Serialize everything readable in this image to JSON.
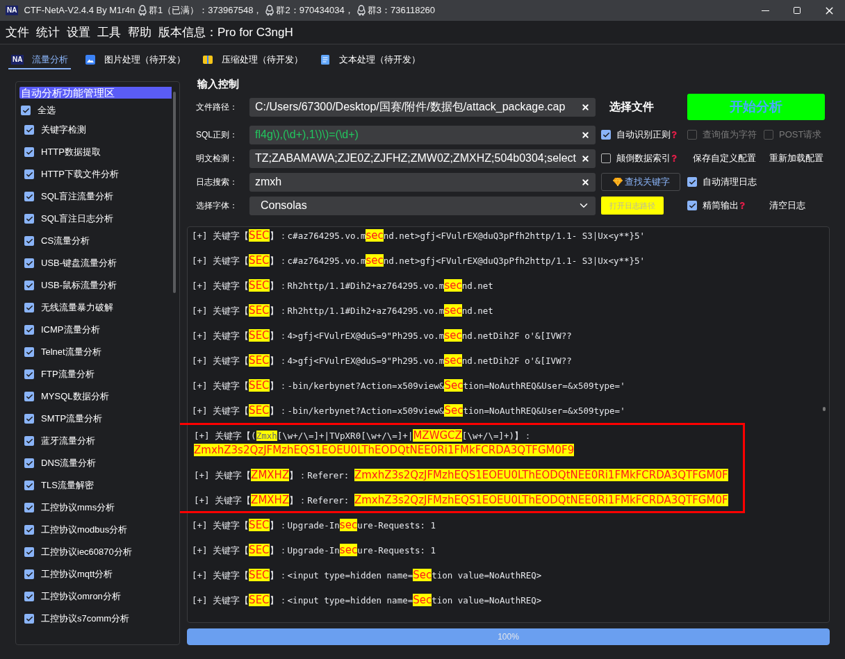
{
  "window": {
    "icon_text": "NA",
    "title": "CTF-NetA-V2.4.4 By M1r4n",
    "groups": [
      "群1（已满）：373967548，",
      "群2：970434034，",
      "群3：736118260"
    ]
  },
  "menu": [
    "文件",
    "统计",
    "设置",
    "工具",
    "帮助",
    "版本信息：Pro for C3ngH"
  ],
  "tabs": [
    {
      "label": "流量分析",
      "selected": true,
      "kind": "badge",
      "icon_text": "NA"
    },
    {
      "label": "图片处理（待开发）",
      "selected": false,
      "kind": "image"
    },
    {
      "label": "压缩处理（待开发）",
      "selected": false,
      "kind": "archive"
    },
    {
      "label": "文本处理（待开发）",
      "selected": false,
      "kind": "document"
    }
  ],
  "sidebar": {
    "title": "自动分析功能管理区",
    "select_all": {
      "label": "全选",
      "checked": true
    },
    "items": [
      {
        "label": "关键字检测",
        "checked": true
      },
      {
        "label": "HTTP数据提取",
        "checked": true
      },
      {
        "label": "HTTP下载文件分析",
        "checked": true
      },
      {
        "label": "SQL盲注流量分析",
        "checked": true
      },
      {
        "label": "SQL盲注日志分析",
        "checked": true
      },
      {
        "label": "CS流量分析",
        "checked": true
      },
      {
        "label": "USB-键盘流量分析",
        "checked": true
      },
      {
        "label": "USB-鼠标流量分析",
        "checked": true
      },
      {
        "label": "无线流量暴力破解",
        "checked": true
      },
      {
        "label": "ICMP流量分析",
        "checked": true
      },
      {
        "label": "Telnet流量分析",
        "checked": true
      },
      {
        "label": "FTP流量分析",
        "checked": true
      },
      {
        "label": "MYSQL数据分析",
        "checked": true
      },
      {
        "label": "SMTP流量分析",
        "checked": true
      },
      {
        "label": "蓝牙流量分析",
        "checked": true
      },
      {
        "label": "DNS流量分析",
        "checked": true
      },
      {
        "label": "TLS流量解密",
        "checked": true
      },
      {
        "label": "工控协议mms分析",
        "checked": true
      },
      {
        "label": "工控协议modbus分析",
        "checked": true
      },
      {
        "label": "工控协议iec60870分析",
        "checked": true
      },
      {
        "label": "工控协议mqtt分析",
        "checked": true
      },
      {
        "label": "工控协议omron分析",
        "checked": true
      },
      {
        "label": "工控协议s7comm分析",
        "checked": true
      }
    ]
  },
  "input_control": {
    "title": "输入控制",
    "rows": [
      {
        "label": "文件路径：",
        "field": {
          "kind": "text",
          "value": "C:/Users/67300/Desktop/国赛/附件/数据包/attack_package.cap"
        },
        "controls": [
          {
            "kind": "text-button",
            "label": "选择文件"
          },
          {
            "kind": "primary-button",
            "label": "开始分析"
          }
        ]
      },
      {
        "label": "SQL正则：",
        "field": {
          "kind": "regex",
          "value": "fl4g\\),(\\d+),1\\)\\)=(\\d+)"
        },
        "controls": [
          {
            "kind": "checkbox",
            "label": "自动识别正则",
            "checked": true,
            "disabled": false,
            "help": true
          },
          {
            "kind": "checkbox",
            "label": "查询值为字符",
            "checked": false,
            "disabled": true,
            "help": false
          },
          {
            "kind": "checkbox",
            "label": "POST请求",
            "checked": false,
            "disabled": true,
            "help": false
          }
        ]
      },
      {
        "label": "明文检测：",
        "field": {
          "kind": "text",
          "value": "TZ;ZABAMAWA;ZJE0Z;ZJFHZ;ZMW0Z;ZMXHZ;504b0304;select"
        },
        "controls": [
          {
            "kind": "checkbox",
            "label": "颠倒数据索引",
            "checked": false,
            "disabled": false,
            "help": true
          },
          {
            "kind": "small-button",
            "label": "保存自定义配置"
          },
          {
            "kind": "small-button",
            "label": "重新加载配置"
          }
        ]
      },
      {
        "label": "日志搜索：",
        "field": {
          "kind": "text",
          "value": "zmxh"
        },
        "controls": [
          {
            "kind": "search-button",
            "label": "查找关键字"
          },
          {
            "kind": "checkbox",
            "label": "自动清理日志",
            "checked": true,
            "disabled": false,
            "help": false
          }
        ]
      },
      {
        "label": "选择字体：",
        "field": {
          "kind": "select",
          "value": "Consolas"
        },
        "controls": [
          {
            "kind": "yellow-button",
            "label": "打开日志路径"
          },
          {
            "kind": "checkbox",
            "label": "精简输出",
            "checked": true,
            "disabled": false,
            "help": true
          },
          {
            "kind": "small-button",
            "label": "清空日志"
          }
        ]
      }
    ]
  },
  "log": [
    {
      "boxed": false,
      "entries": [
        [
          [
            {
              "text": "[+] 关键字【",
              "kind": "plain"
            },
            {
              "text": "SEC",
              "kind": "keyword"
            },
            {
              "text": "】：c#az764295.vo.m",
              "kind": "plain"
            },
            {
              "text": "sec",
              "kind": "keyword"
            },
            {
              "text": "nd.net>gfj<FVulrEX@duQ3pPfh2http/1.1- S3|Ux<y**}5'",
              "kind": "plain"
            }
          ]
        ],
        [
          [
            {
              "text": "[+] 关键字【",
              "kind": "plain"
            },
            {
              "text": "SEC",
              "kind": "keyword"
            },
            {
              "text": "】：c#az764295.vo.m",
              "kind": "plain"
            },
            {
              "text": "sec",
              "kind": "keyword"
            },
            {
              "text": "nd.net>gfj<FVulrEX@duQ3pPfh2http/1.1- S3|Ux<y**}5'",
              "kind": "plain"
            }
          ]
        ],
        [
          [
            {
              "text": "[+] 关键字【",
              "kind": "plain"
            },
            {
              "text": "SEC",
              "kind": "keyword"
            },
            {
              "text": "】：Rh2http/1.1#Dih2+az764295.vo.m",
              "kind": "plain"
            },
            {
              "text": "sec",
              "kind": "keyword"
            },
            {
              "text": "nd.net",
              "kind": "plain"
            }
          ]
        ],
        [
          [
            {
              "text": "[+] 关键字【",
              "kind": "plain"
            },
            {
              "text": "SEC",
              "kind": "keyword"
            },
            {
              "text": "】：Rh2http/1.1#Dih2+az764295.vo.m",
              "kind": "plain"
            },
            {
              "text": "sec",
              "kind": "keyword"
            },
            {
              "text": "nd.net",
              "kind": "plain"
            }
          ]
        ],
        [
          [
            {
              "text": "[+] 关键字【",
              "kind": "plain"
            },
            {
              "text": "SEC",
              "kind": "keyword"
            },
            {
              "text": "】：4>gfj<FVulrEX@duS=9\"Ph295.vo.m",
              "kind": "plain"
            },
            {
              "text": "sec",
              "kind": "keyword"
            },
            {
              "text": "nd.netDih2F o'&[IVW??",
              "kind": "plain"
            }
          ]
        ],
        [
          [
            {
              "text": "[+] 关键字【",
              "kind": "plain"
            },
            {
              "text": "SEC",
              "kind": "keyword"
            },
            {
              "text": "】：4>gfj<FVulrEX@duS=9\"Ph295.vo.m",
              "kind": "plain"
            },
            {
              "text": "sec",
              "kind": "keyword"
            },
            {
              "text": "nd.netDih2F o'&[IVW??",
              "kind": "plain"
            }
          ]
        ],
        [
          [
            {
              "text": "[+] 关键字【",
              "kind": "plain"
            },
            {
              "text": "SEC",
              "kind": "keyword"
            },
            {
              "text": "】：-bin/kerbynet?Action=x509view&",
              "kind": "plain"
            },
            {
              "text": "Sec",
              "kind": "keyword"
            },
            {
              "text": "tion=NoAuthREQ&User=&x509type='",
              "kind": "plain"
            }
          ]
        ],
        [
          [
            {
              "text": "[+] 关键字【",
              "kind": "plain"
            },
            {
              "text": "SEC",
              "kind": "keyword"
            },
            {
              "text": "】：-bin/kerbynet?Action=x509view&",
              "kind": "plain"
            },
            {
              "text": "Sec",
              "kind": "keyword"
            },
            {
              "text": "tion=NoAuthREQ&User=&x509type='",
              "kind": "plain"
            }
          ]
        ]
      ]
    },
    {
      "boxed": true,
      "entries": [
        [
          [
            {
              "text": "[+] 关键字【(",
              "kind": "plain"
            },
            {
              "text": "Zmxh",
              "kind": "faint-keyword"
            },
            {
              "text": "[\\w+/\\=]+|TVpXR0[\\w+/\\=]+|",
              "kind": "plain"
            },
            {
              "text": "MZWGCZ",
              "kind": "keyword"
            },
            {
              "text": "[\\w+/\\=]+)】：",
              "kind": "plain"
            }
          ],
          [
            {
              "text": "ZmxhZ3s2QzJFMzhEQS1EOEU0LThEODQtNEE0Ri1FMkFCRDA3QTFGM0F9",
              "kind": "keyword"
            }
          ]
        ],
        [
          [
            {
              "text": "[+] 关键字【",
              "kind": "plain"
            },
            {
              "text": "ZMXHZ",
              "kind": "keyword"
            },
            {
              "text": "】：Referer: ",
              "kind": "plain"
            },
            {
              "text": "ZmxhZ3s2QzJFMzhEQS1EOEU0LThEODQtNEE0Ri1FMkFCRDA3QTFGM0F",
              "kind": "keyword"
            }
          ]
        ],
        [
          [
            {
              "text": "[+] 关键字【",
              "kind": "plain"
            },
            {
              "text": "ZMXHZ",
              "kind": "keyword"
            },
            {
              "text": "】：Referer: ",
              "kind": "plain"
            },
            {
              "text": "ZmxhZ3s2QzJFMzhEQS1EOEU0LThEODQtNEE0Ri1FMkFCRDA3QTFGM0F",
              "kind": "keyword"
            }
          ]
        ]
      ]
    },
    {
      "boxed": false,
      "entries": [
        [
          [
            {
              "text": "[+] 关键字【",
              "kind": "plain"
            },
            {
              "text": "SEC",
              "kind": "keyword"
            },
            {
              "text": "】：Upgrade-In",
              "kind": "plain"
            },
            {
              "text": "sec",
              "kind": "keyword"
            },
            {
              "text": "ure-Requests: 1",
              "kind": "plain"
            }
          ]
        ],
        [
          [
            {
              "text": "[+] 关键字【",
              "kind": "plain"
            },
            {
              "text": "SEC",
              "kind": "keyword"
            },
            {
              "text": "】：Upgrade-In",
              "kind": "plain"
            },
            {
              "text": "sec",
              "kind": "keyword"
            },
            {
              "text": "ure-Requests: 1",
              "kind": "plain"
            }
          ]
        ],
        [
          [
            {
              "text": "[+] 关键字【",
              "kind": "plain"
            },
            {
              "text": "SEC",
              "kind": "keyword"
            },
            {
              "text": "】：<input type=hidden name=",
              "kind": "plain"
            },
            {
              "text": "Sec",
              "kind": "keyword"
            },
            {
              "text": "tion value=NoAuthREQ>",
              "kind": "plain"
            }
          ]
        ],
        [
          [
            {
              "text": "[+] 关键字【",
              "kind": "plain"
            },
            {
              "text": "SEC",
              "kind": "keyword"
            },
            {
              "text": "】：<input type=hidden name=",
              "kind": "plain"
            },
            {
              "text": "Sec",
              "kind": "keyword"
            },
            {
              "text": "tion value=NoAuthREQ>",
              "kind": "plain"
            }
          ]
        ]
      ]
    }
  ],
  "progress": {
    "level": 1,
    "reading": "100%"
  }
}
